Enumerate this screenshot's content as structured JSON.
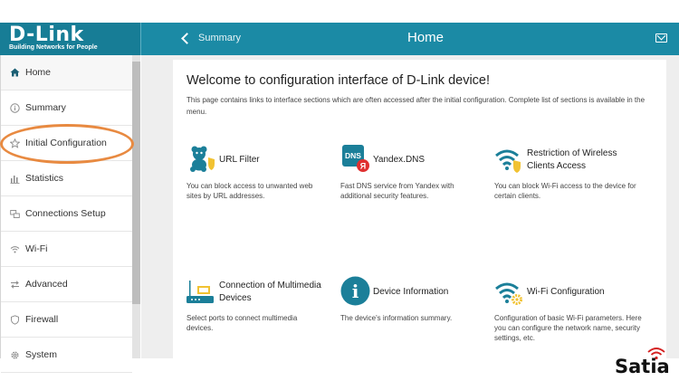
{
  "header": {
    "logo_main": "D-Link",
    "logo_tagline": "Building Networks for People",
    "back_label": "Summary",
    "page_title": "Home"
  },
  "sidebar": {
    "items": [
      {
        "label": "Home",
        "icon": "home-icon",
        "active": true
      },
      {
        "label": "Summary",
        "icon": "info-icon"
      },
      {
        "label": "Initial Configuration",
        "icon": "star-icon"
      },
      {
        "label": "Statistics",
        "icon": "bar-chart-icon"
      },
      {
        "label": "Connections Setup",
        "icon": "connections-icon"
      },
      {
        "label": "Wi-Fi",
        "icon": "wifi-icon"
      },
      {
        "label": "Advanced",
        "icon": "arrows-icon"
      },
      {
        "label": "Firewall",
        "icon": "shield-icon"
      },
      {
        "label": "System",
        "icon": "gear-icon"
      }
    ]
  },
  "main": {
    "welcome": "Welcome to configuration interface of D-Link device!",
    "intro": "This page contains links to interface sections which are often accessed after the initial configuration. Complete list of sections is available in the menu.",
    "cards": [
      {
        "title": "URL Filter",
        "desc": "You can block access to unwanted web sites by URL addresses.",
        "icon": "url-filter-icon"
      },
      {
        "title": "Yandex.DNS",
        "desc": "Fast DNS service from Yandex with additional security features.",
        "icon": "yandex-dns-icon",
        "icon_text": "DNS",
        "icon_badge": "Я"
      },
      {
        "title": "Restriction of Wireless Clients Access",
        "desc": "You can block Wi-Fi access to the device for certain clients.",
        "icon": "wifi-shield-icon"
      },
      {
        "title": "Connection of Multimedia Devices",
        "desc": "Select ports to connect multimedia devices.",
        "icon": "multimedia-router-icon"
      },
      {
        "title": "Device Information",
        "desc": "The device's information summary.",
        "icon": "device-info-icon",
        "icon_text": "i"
      },
      {
        "title": "Wi-Fi Configuration",
        "desc": "Configuration of basic Wi-Fi parameters. Here you can configure the network name, security settings, etc.",
        "icon": "wifi-gear-icon"
      }
    ]
  },
  "watermark": "Satia",
  "colors": {
    "header": "#1b8aa5",
    "logo_bg": "#177d96",
    "accent": "#1b7f99",
    "highlight": "#e88a41",
    "shield": "#f1c232"
  }
}
